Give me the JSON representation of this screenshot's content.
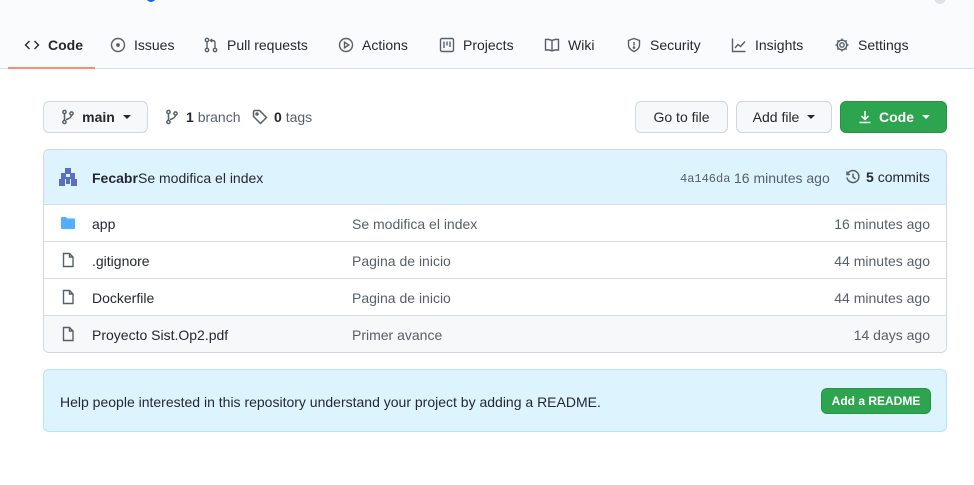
{
  "tabs": [
    {
      "label": "Code",
      "icon": "code-icon"
    },
    {
      "label": "Issues",
      "icon": "issue-icon"
    },
    {
      "label": "Pull requests",
      "icon": "pull-request-icon"
    },
    {
      "label": "Actions",
      "icon": "play-icon"
    },
    {
      "label": "Projects",
      "icon": "project-icon"
    },
    {
      "label": "Wiki",
      "icon": "book-icon"
    },
    {
      "label": "Security",
      "icon": "shield-icon"
    },
    {
      "label": "Insights",
      "icon": "graph-icon"
    },
    {
      "label": "Settings",
      "icon": "gear-icon"
    }
  ],
  "toolbar": {
    "branch_button": "main",
    "branch_count": "1",
    "branch_word": "branch",
    "tag_count": "0",
    "tag_word": "tags",
    "go_to_file": "Go to file",
    "add_file": "Add file",
    "code_button": "Code"
  },
  "commit": {
    "author": "Fecabr",
    "message": "Se modifica el index",
    "sha": "4a146da",
    "time": "16 minutes ago",
    "count": "5",
    "count_word": "commits"
  },
  "files": [
    {
      "name": "app",
      "type": "folder",
      "message": "Se modifica el index",
      "time": "16 minutes ago"
    },
    {
      "name": ".gitignore",
      "type": "file",
      "message": "Pagina de inicio",
      "time": "44 minutes ago"
    },
    {
      "name": "Dockerfile",
      "type": "file",
      "message": "Pagina de inicio",
      "time": "44 minutes ago"
    },
    {
      "name": "Proyecto Sist.Op2.pdf",
      "type": "file",
      "message": "Primer avance",
      "time": "14 days ago"
    }
  ],
  "readme": {
    "text": "Help people interested in this repository understand your project by adding a README.",
    "button": "Add a README"
  },
  "colors": {
    "accent_green": "#2da44e",
    "tab_underline": "#fd8c73",
    "info_blue": "#ddf4ff",
    "folder_blue": "#54aeff"
  }
}
